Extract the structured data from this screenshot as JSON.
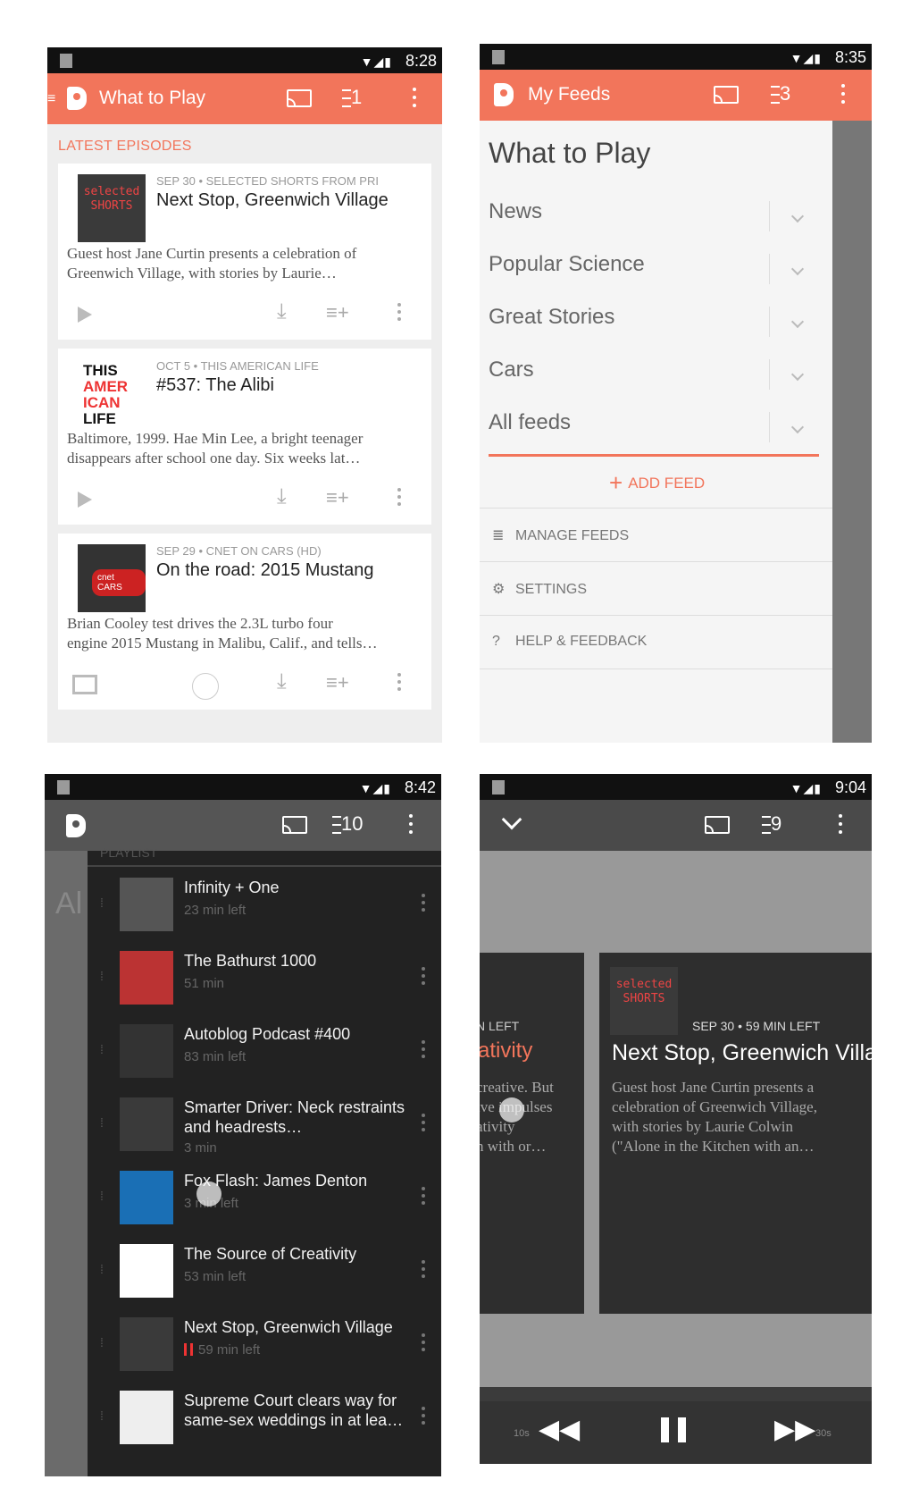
{
  "screens": [
    {
      "status_time": "8:28",
      "app_title": "What to Play",
      "queue_count": "1",
      "section_label": "LATEST EPISODES",
      "episodes": [
        {
          "meta": "SEP 30 • SELECTED SHORTS FROM PRI",
          "title": "Next Stop, Greenwich Village",
          "desc1": "Guest host Jane Curtin presents a celebration of",
          "desc2": "Greenwich Village, with stories by Laurie…",
          "art": "selected SHORTS"
        },
        {
          "meta": "OCT 5 • THIS AMERICAN LIFE",
          "title": "#537: The Alibi",
          "desc1": "Baltimore, 1999. Hae Min Lee, a bright teenager",
          "desc2": "disappears after school one day. Six weeks lat…",
          "art": "THIS AMERICAN LIFE"
        },
        {
          "meta": "SEP 29 • CNET ON CARS (HD)",
          "title": "On the road: 2015 Mustang",
          "desc1": "Brian Cooley test drives the 2.3L turbo four",
          "desc2": "engine 2015 Mustang in Malibu, Calif., and tells…",
          "art": "cnet CARS"
        }
      ]
    },
    {
      "status_time": "8:35",
      "app_title": "My Feeds",
      "queue_count": "3",
      "drawer_title": "What to Play",
      "feeds": [
        "News",
        "Popular Science",
        "Great Stories",
        "Cars",
        "All feeds"
      ],
      "add_feed": "ADD FEED",
      "menu": [
        "MANAGE FEEDS",
        "SETTINGS",
        "HELP & FEEDBACK"
      ]
    },
    {
      "status_time": "8:42",
      "queue_count": "10",
      "playlist_header": "PLAYLIST",
      "bg_text": "Al",
      "playlist": [
        {
          "title": "Infinity + One",
          "sub": "23 min left"
        },
        {
          "title": "The Bathurst 1000",
          "sub": "51 min"
        },
        {
          "title": "Autoblog Podcast #400",
          "sub": "83 min left"
        },
        {
          "title": "Smarter Driver: Neck restraints and headrests…",
          "sub": "3 min"
        },
        {
          "title": "Fox Flash: James Denton",
          "sub": "3 min left"
        },
        {
          "title": "The Source of Creativity",
          "sub": "53 min left"
        },
        {
          "title": "Next Stop, Greenwich Village",
          "sub": "59 min left"
        },
        {
          "title": "Supreme Court clears way for same-sex weddings in at lea…",
          "sub": ""
        }
      ]
    },
    {
      "status_time": "9:04",
      "queue_count": "9",
      "left_card": {
        "meta": "N LEFT",
        "title": "ativity",
        "d1": "creative. But",
        "d2": "ive impulses",
        "d3": "ativity",
        "d4": "n with or…"
      },
      "now_playing": {
        "meta": "SEP 30 • 59 MIN LEFT",
        "title": "Next Stop, Greenwich Village",
        "d1": "Guest host Jane Curtin presents a",
        "d2": "celebration of Greenwich Village,",
        "d3": "with stories by Laurie Colwin",
        "d4": "(\"Alone in the Kitchen with an…",
        "art": "selected SHORTS"
      },
      "rewind_label": "10s",
      "forward_label": "30s"
    }
  ],
  "colors": {
    "accent": "#f2755b",
    "dark": "#222222"
  }
}
